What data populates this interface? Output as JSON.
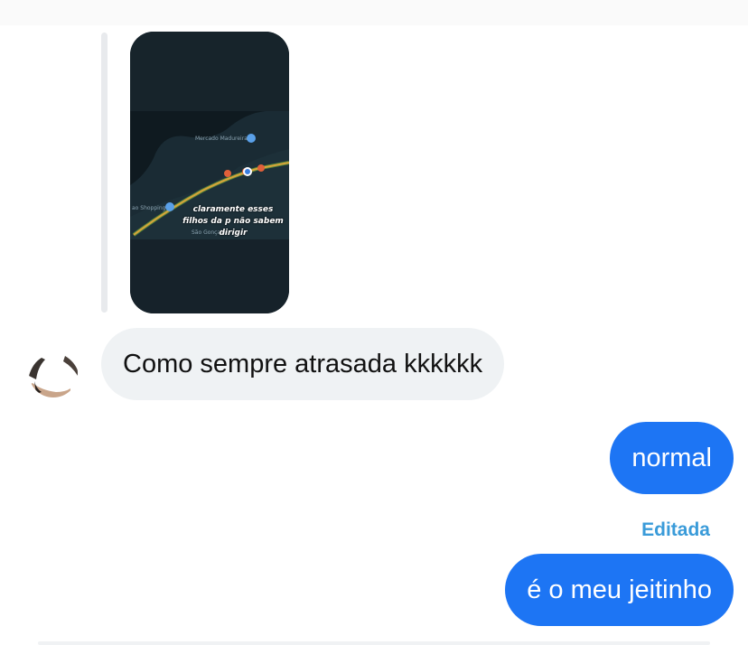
{
  "chat": {
    "reply_preview": {
      "map_labels": {
        "place_top": "Mercado Madureira",
        "place_left": "ao Shopping",
        "place_bottom": "São Gonçalo"
      },
      "caption": "claramente esses\nfilhos da p não sabem\ndirigir"
    },
    "messages": [
      {
        "direction": "incoming",
        "text": "Como sempre atrasada kkkkkk"
      },
      {
        "direction": "outgoing",
        "text": "normal"
      },
      {
        "direction": "outgoing",
        "text": "é o meu jeitinho",
        "status": "Editada"
      }
    ]
  },
  "colors": {
    "outgoing_bubble": "#1d75f4",
    "incoming_bubble": "#eff2f4",
    "edited_label": "#3a9bd9",
    "reply_bar": "#e8eaed"
  }
}
